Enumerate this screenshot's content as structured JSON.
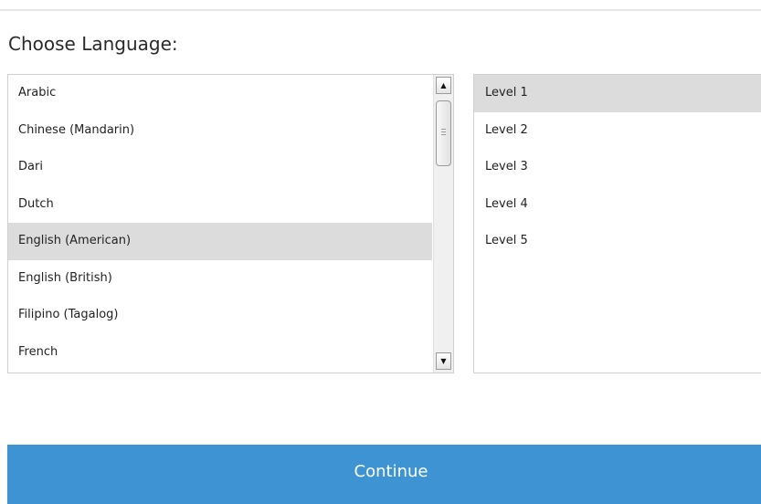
{
  "heading": "Choose Language:",
  "languages": {
    "items": [
      {
        "label": "Arabic"
      },
      {
        "label": "Chinese (Mandarin)"
      },
      {
        "label": "Dari"
      },
      {
        "label": "Dutch"
      },
      {
        "label": "English (American)"
      },
      {
        "label": "English (British)"
      },
      {
        "label": "Filipino (Tagalog)"
      },
      {
        "label": "French"
      }
    ],
    "selected": "English (American)"
  },
  "levels": {
    "items": [
      {
        "label": "Level 1"
      },
      {
        "label": "Level 2"
      },
      {
        "label": "Level 3"
      },
      {
        "label": "Level 4"
      },
      {
        "label": "Level 5"
      }
    ],
    "selected": "Level 1"
  },
  "continue_label": "Continue",
  "icons": {
    "scroll_up": "scroll-up-arrow-icon",
    "scroll_down": "scroll-down-arrow-icon"
  },
  "colors": {
    "accent": "#3e94d3",
    "selected_row": "#dcdcdc"
  }
}
